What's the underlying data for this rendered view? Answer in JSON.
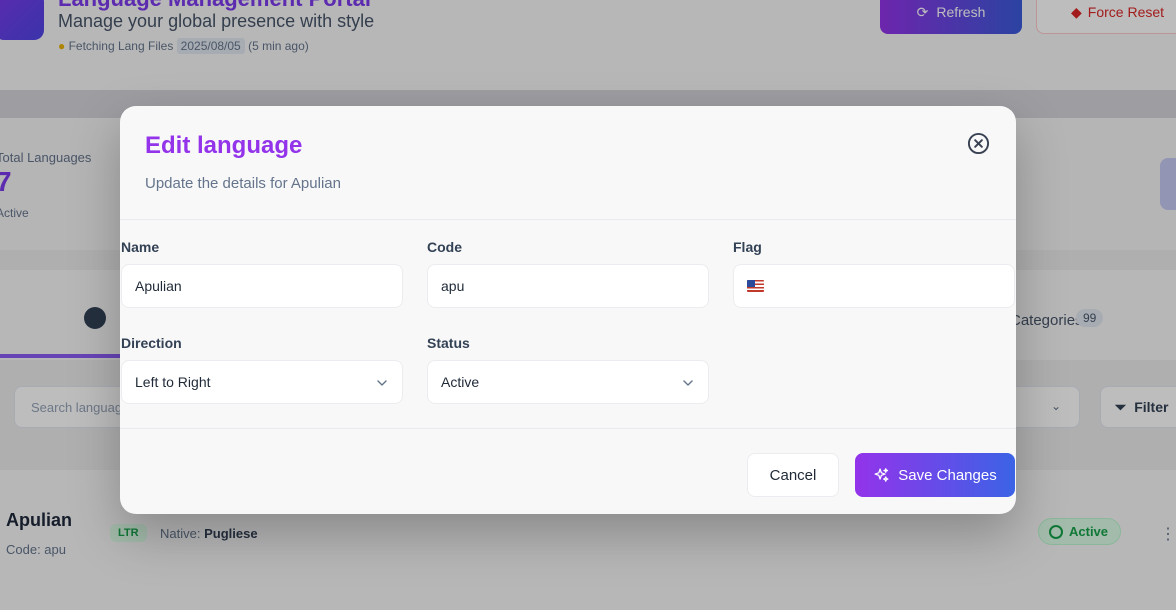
{
  "background": {
    "header": {
      "title": "Language Management Portal",
      "subtitle": "Manage your global presence with style",
      "meta_prefix": "Fetching Lang Files",
      "meta_date": "2025/08/05",
      "meta_suffix": "(5 min ago)",
      "refresh_label": "Refresh",
      "force_label": "Force Reset"
    },
    "stats": {
      "label": "Total Languages",
      "value": "7",
      "caption": "Active"
    },
    "tabs": {
      "categories_label": "Categories",
      "categories_count": "99"
    },
    "search": {
      "placeholder": "Search languages by name, code, or native name..."
    },
    "filter_label": "Filter",
    "row": {
      "name": "Apulian",
      "code_text": "Code: apu",
      "direction_badge": "LTR",
      "native_prefix": "Native:",
      "native_name": "Pugliese",
      "status": "Active"
    }
  },
  "modal": {
    "title": "Edit language",
    "description": "Update the details for Apulian",
    "fields": {
      "name": {
        "label": "Name",
        "value": "Apulian"
      },
      "code": {
        "label": "Code",
        "value": "apu"
      },
      "flag": {
        "label": "Flag",
        "value": "US flag"
      },
      "direction": {
        "label": "Direction",
        "value": "Left to Right"
      },
      "status": {
        "label": "Status",
        "value": "Active"
      }
    },
    "cancel_label": "Cancel",
    "save_label": "Save Changes"
  },
  "colors": {
    "accent": "#9333ea",
    "gradient_end": "#3b63e6"
  },
  "icons": [
    "close-circle-icon",
    "chevron-down-icon",
    "sparkles-icon",
    "us-flag-icon"
  ]
}
